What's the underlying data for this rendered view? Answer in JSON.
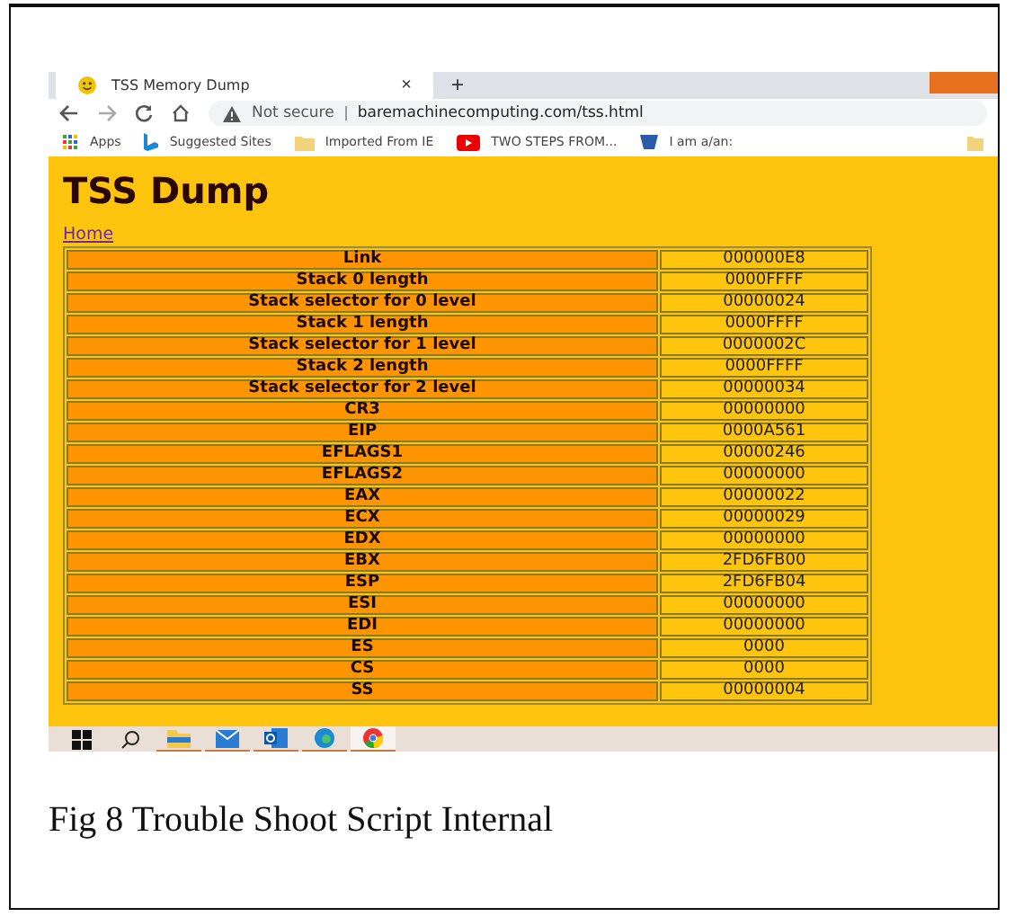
{
  "browser": {
    "tab": {
      "title": "TSS Memory Dump",
      "close": "×"
    },
    "new_tab": "+",
    "address": {
      "security": "Not secure",
      "url": "baremachinecomputing.com/tss.html"
    },
    "bookmarks": [
      {
        "label": "Apps",
        "kind": "apps"
      },
      {
        "label": "Suggested Sites",
        "kind": "bing"
      },
      {
        "label": "Imported From IE",
        "kind": "folder"
      },
      {
        "label": "TWO STEPS FROM...",
        "kind": "youtube"
      },
      {
        "label": "I am a/an:",
        "kind": "shield"
      }
    ]
  },
  "page": {
    "heading": "TSS Dump",
    "link": "Home",
    "rows": [
      {
        "name": "Link",
        "value": "000000E8"
      },
      {
        "name": "Stack 0 length",
        "value": "0000FFFF"
      },
      {
        "name": "Stack selector for 0 level",
        "value": "00000024"
      },
      {
        "name": "Stack 1 length",
        "value": "0000FFFF"
      },
      {
        "name": "Stack selector for 1 level",
        "value": "0000002C"
      },
      {
        "name": "Stack 2 length",
        "value": "0000FFFF"
      },
      {
        "name": "Stack selector for 2 level",
        "value": "00000034"
      },
      {
        "name": "CR3",
        "value": "00000000"
      },
      {
        "name": "EIP",
        "value": "0000A561"
      },
      {
        "name": "EFLAGS1",
        "value": "00000246"
      },
      {
        "name": "EFLAGS2",
        "value": "00000000"
      },
      {
        "name": "EAX",
        "value": "00000022"
      },
      {
        "name": "ECX",
        "value": "00000029"
      },
      {
        "name": "EDX",
        "value": "00000000"
      },
      {
        "name": "EBX",
        "value": "2FD6FB00"
      },
      {
        "name": "ESP",
        "value": "2FD6FB04"
      },
      {
        "name": "ESI",
        "value": "00000000"
      },
      {
        "name": "EDI",
        "value": "00000000"
      },
      {
        "name": "ES",
        "value": "0000"
      },
      {
        "name": "CS",
        "value": "0000"
      },
      {
        "name": "SS",
        "value": "00000004"
      }
    ]
  },
  "taskbar": [
    {
      "kind": "windows"
    },
    {
      "kind": "search"
    },
    {
      "kind": "folder",
      "selected": false
    },
    {
      "kind": "mail",
      "selected": false
    },
    {
      "kind": "outlook",
      "selected": false
    },
    {
      "kind": "edge",
      "selected": false
    },
    {
      "kind": "chrome",
      "selected": true
    }
  ],
  "caption": "Fig 8 Trouble Shoot Script Internal"
}
